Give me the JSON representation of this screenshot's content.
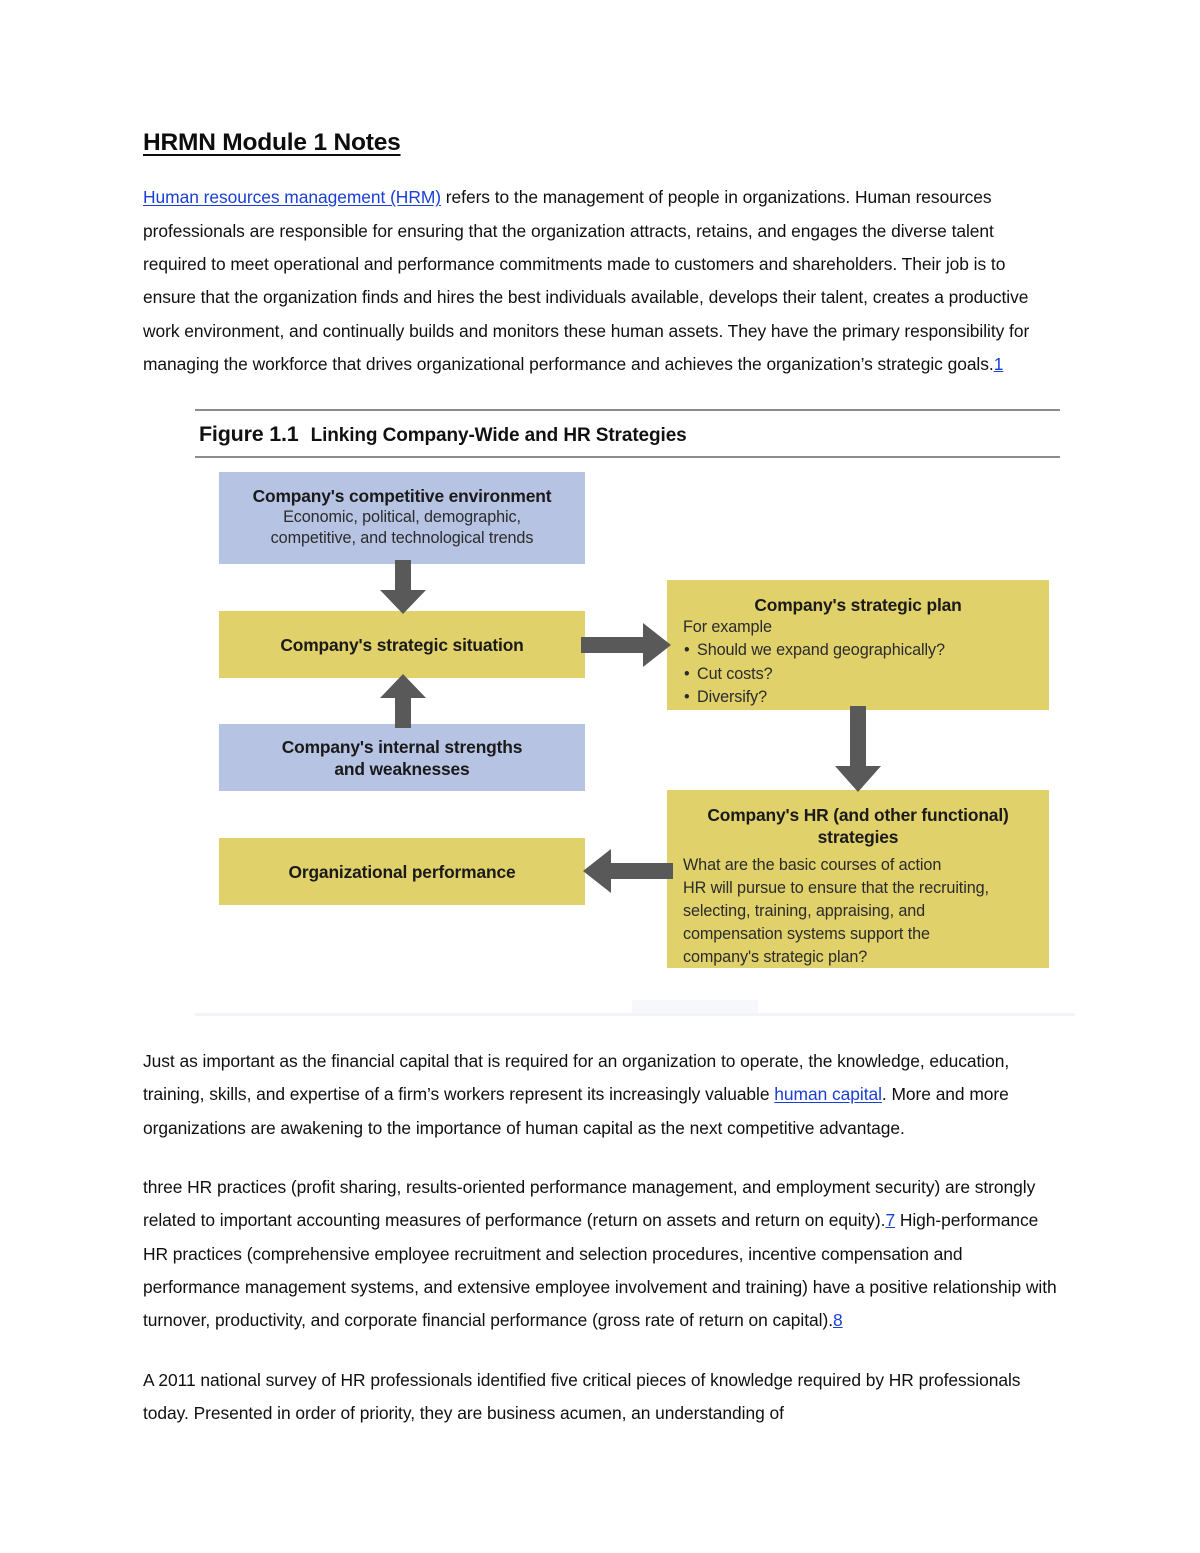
{
  "document": {
    "title": "HRMN Module 1 Notes",
    "paragraphs": {
      "p1": {
        "link_text": "Human resources management (HRM)",
        "rest": " refers to the management of people in organizations. Human resources professionals are responsible for ensuring that the organization attracts, retains, and engages the diverse talent required to meet operational and performance commitments made to customers and shareholders. Their job is to ensure that the organization finds and hires the best individuals available, develops their talent, creates a productive work environment, and continually builds and monitors these human assets. They have the primary responsibility for managing the workforce that drives organizational performance and achieves the organization’s strategic goals.",
        "endnote": "1"
      },
      "p2": {
        "before_link": "Just as important as the financial capital that is required for an organization to operate, the knowledge, education, training, skills, and expertise of a firm’s workers represent its increasingly valuable ",
        "link_text": "human capital",
        "after_link": ". More and more organizations are awakening to the importance of human capital as the next competitive advantage."
      },
      "p3": {
        "seg1": "three HR practices (profit sharing, results-oriented performance management, and employment security) are strongly related to important accounting measures of performance (return on assets and return on equity).",
        "endnote1": "7",
        "seg2": " High-performance HR practices (comprehensive employee recruitment and selection procedures, incentive compensation and performance management systems, and extensive employee involvement and training) have a positive relationship with turnover, productivity, and corporate financial performance (gross rate of return on capital).",
        "endnote2": "8"
      },
      "p4": {
        "text": "A 2011 national survey of HR professionals identified five critical pieces of knowledge required by HR professionals today. Presented in order of priority, they are business acumen, an understanding of"
      }
    }
  },
  "figure": {
    "number": "Figure 1.1",
    "title": "Linking Company-Wide and HR Strategies",
    "colors": {
      "blue_box": "#b6c3e2",
      "gold_box": "#e0d16a",
      "arrow": "#595959",
      "rule": "#8c8c8c"
    },
    "boxes": {
      "environment": {
        "heading": "Company's competitive environment",
        "line1": "Economic, political, demographic,",
        "line2": "competitive, and technological trends"
      },
      "situation": {
        "heading": "Company's strategic situation"
      },
      "weaknesses": {
        "heading_line1": "Company's internal strengths",
        "heading_line2": "and weaknesses"
      },
      "performance": {
        "heading": "Organizational performance"
      },
      "strategic_plan": {
        "heading": "Company's strategic plan",
        "intro": "For example",
        "bullets": [
          "Should we expand geographically?",
          "Cut costs?",
          "Diversify?"
        ]
      },
      "hr_strategies": {
        "heading_line1": "Company's HR (and other functional)",
        "heading_line2": "strategies",
        "body_line1": "What are the basic courses of action",
        "body_line2": "HR will pursue to ensure that the recruiting,",
        "body_line3": "selecting, training, appraising, and",
        "body_line4": "compensation systems support the",
        "body_line5": "company's strategic plan?"
      }
    }
  }
}
